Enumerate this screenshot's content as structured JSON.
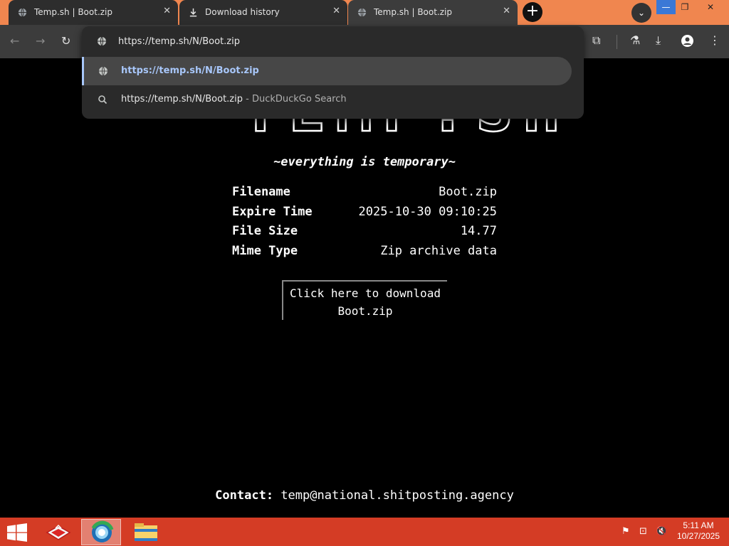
{
  "browser": {
    "tabs": [
      {
        "title": "Temp.sh | Boot.zip",
        "icon": "globe-icon"
      },
      {
        "title": "Download history",
        "icon": "download-icon"
      },
      {
        "title": "Temp.sh | Boot.zip",
        "icon": "globe-icon"
      }
    ],
    "url": "https://temp.sh/N/Boot.zip",
    "suggestions": [
      {
        "text": "https://temp.sh/N/Boot.zip",
        "suffix": ""
      },
      {
        "text": "https://temp.sh/N/Boot.zip",
        "suffix": " - DuckDuckGo Search"
      }
    ],
    "colors": {
      "frame": "#f0864f",
      "toolbar": "#3c3c3c",
      "accent": "#a8c7fa"
    }
  },
  "page": {
    "banner_text": "TEMP.SH",
    "tagline": "~everything is temporary~",
    "info": [
      {
        "label": "Filename",
        "value": "Boot.zip"
      },
      {
        "label": "Expire Time",
        "value": "2025-10-30 09:10:25"
      },
      {
        "label": "File Size",
        "value": "14.77"
      },
      {
        "label": "Mime Type",
        "value": "Zip archive data"
      }
    ],
    "download_line1": "Click here to download",
    "download_line2": "Boot.zip",
    "contact_label": "Contact:",
    "contact_email": "temp@national.shitposting.agency"
  },
  "taskbar": {
    "time": "5:11 AM",
    "date": "10/27/2025",
    "color": "#d43c25"
  }
}
